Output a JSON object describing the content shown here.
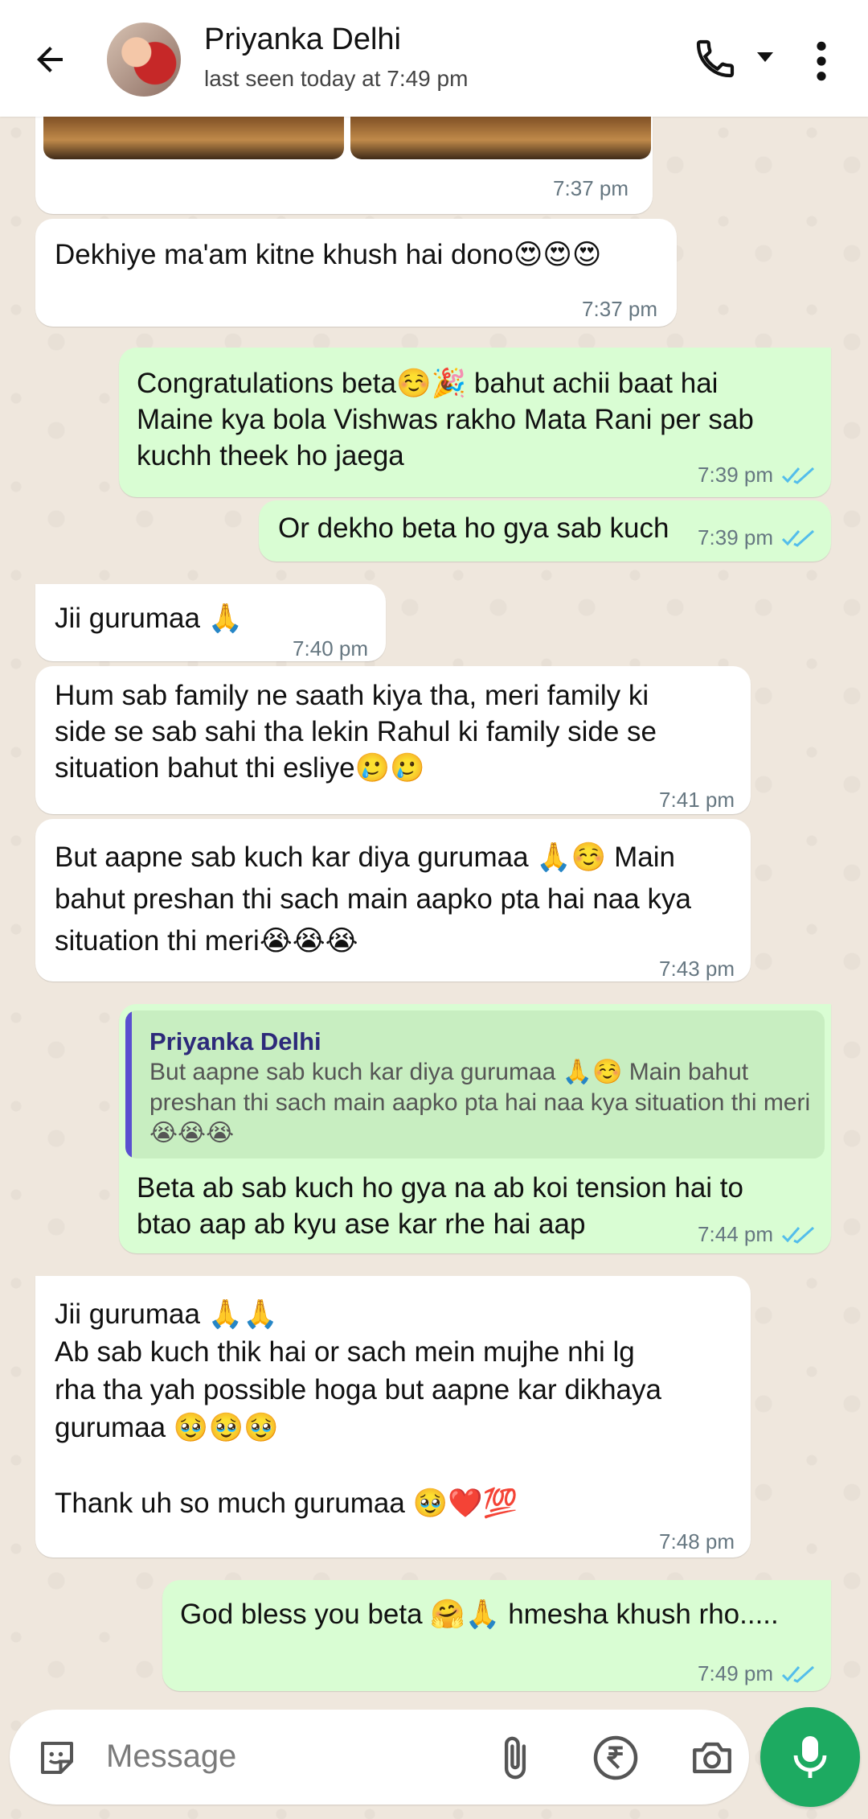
{
  "header": {
    "contact_name": "Priyanka Delhi",
    "status": "last seen today at 7:49 pm"
  },
  "messages": [
    {
      "direction": "in",
      "type": "image",
      "time": "7:37 pm"
    },
    {
      "direction": "in",
      "text": "Dekhiye ma'am kitne khush hai dono😍😍😍",
      "time": "7:37 pm"
    },
    {
      "direction": "out",
      "text": "Congratulations beta☺️🎉 bahut achii baat hai\nMaine kya bola Vishwas rakho Mata Rani per sab\nkuchh theek ho jaega",
      "time": "7:39 pm"
    },
    {
      "direction": "out",
      "text": "Or dekho beta ho gya sab kuch",
      "time": "7:39 pm"
    },
    {
      "direction": "in",
      "text": "Jii gurumaa 🙏",
      "time": "7:40 pm"
    },
    {
      "direction": "in",
      "text": "Hum sab family ne saath kiya tha, meri family ki\nside se sab sahi tha lekin Rahul ki family side se\nsituation bahut thi esliye🥲🥲",
      "time": "7:41 pm"
    },
    {
      "direction": "in",
      "text": "But aapne sab kuch kar diya gurumaa 🙏☺️ Main\nbahut preshan thi sach main aapko pta hai naa kya\nsituation thi meri😭😭😭",
      "time": "7:43 pm"
    },
    {
      "direction": "out",
      "quote_name": "Priyanka Delhi",
      "quote_text": "But aapne sab kuch kar diya gurumaa 🙏☺️ Main bahut preshan thi sach main aapko pta hai naa kya situation thi meri😭😭😭",
      "text": "Beta ab sab kuch ho gya na ab koi tension hai to\nbtao aap ab kyu ase kar rhe hai aap",
      "time": "7:44 pm"
    },
    {
      "direction": "in",
      "text": "Jii gurumaa 🙏🙏\nAb sab kuch thik hai or sach mein mujhe nhi lg\nrha tha yah possible hoga but aapne kar dikhaya\ngurumaa 🥹🥹🥹\n\nThank uh so much gurumaa 🥹❤️💯",
      "time": "7:48 pm"
    },
    {
      "direction": "out",
      "text": "God bless you beta 🤗🙏 hmesha khush rho.....",
      "time": "7:49 pm"
    }
  ],
  "composer": {
    "placeholder": "Message"
  },
  "colors": {
    "incoming_bubble": "#ffffff",
    "outgoing_bubble": "#d9fdd3",
    "read_ticks": "#53bdeb",
    "mic_button": "#1daa61"
  },
  "icons": [
    "back-arrow-icon",
    "phone-icon",
    "caret-down-icon",
    "more-vert-icon",
    "sticker-icon",
    "attach-icon",
    "rupee-icon",
    "camera-icon",
    "mic-icon",
    "double-check-icon"
  ]
}
